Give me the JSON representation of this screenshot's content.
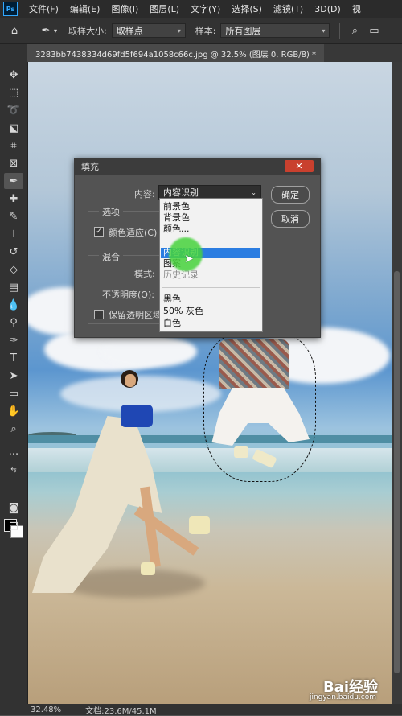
{
  "app": {
    "logo": "Ps",
    "menu": [
      "文件(F)",
      "编辑(E)",
      "图像(I)",
      "图层(L)",
      "文字(Y)",
      "选择(S)",
      "滤镜(T)",
      "3D(D)",
      "视"
    ]
  },
  "options_bar": {
    "sample_size_label": "取样大小:",
    "sample_size_value": "取样点",
    "sample_label": "样本:",
    "sample_value": "所有图层"
  },
  "document": {
    "tab_title": "3283bb7438334d69fd5f694a1058c66c.jpg @ 32.5% (图层 0, RGB/8) *"
  },
  "fill_dialog": {
    "title": "填充",
    "close_label": "✕",
    "content_label": "内容:",
    "content_value": "内容识别",
    "ok_label": "确定",
    "cancel_label": "取消",
    "options_heading": "选项",
    "color_adapt_label": "颜色适应(C)",
    "blend_heading": "混合",
    "mode_label": "模式:",
    "opacity_label": "不透明度(O):",
    "preserve_transparency_label": "保留透明区域"
  },
  "dropdown": {
    "items_top": [
      "前景色",
      "背景色",
      "颜色..."
    ],
    "items_mid": [
      "内容识别",
      "图案",
      "历史记录"
    ],
    "items_bottom": [
      "黑色",
      "50% 灰色",
      "白色"
    ],
    "selected": "内容识别"
  },
  "status": {
    "zoom": "32.48%",
    "doc_size": "文档:23.6M/45.1M"
  },
  "watermark": {
    "brand": "Bai经验",
    "url": "jingyan.baidu.com"
  },
  "colors": {
    "accent_highlight": "#2b7de1",
    "close_button": "#c9402e",
    "foreground_color": "#000000",
    "background_color": "#ffffff"
  }
}
